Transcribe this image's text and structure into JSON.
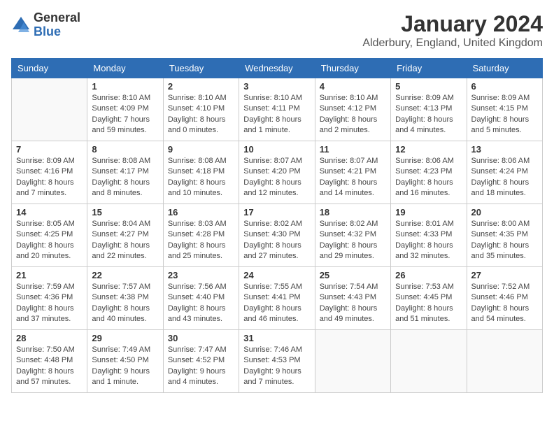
{
  "header": {
    "logo_general": "General",
    "logo_blue": "Blue",
    "month_year": "January 2024",
    "location": "Alderbury, England, United Kingdom"
  },
  "days_of_week": [
    "Sunday",
    "Monday",
    "Tuesday",
    "Wednesday",
    "Thursday",
    "Friday",
    "Saturday"
  ],
  "weeks": [
    [
      {
        "day": "",
        "sunrise": "",
        "sunset": "",
        "daylight": ""
      },
      {
        "day": "1",
        "sunrise": "Sunrise: 8:10 AM",
        "sunset": "Sunset: 4:09 PM",
        "daylight": "Daylight: 7 hours and 59 minutes."
      },
      {
        "day": "2",
        "sunrise": "Sunrise: 8:10 AM",
        "sunset": "Sunset: 4:10 PM",
        "daylight": "Daylight: 8 hours and 0 minutes."
      },
      {
        "day": "3",
        "sunrise": "Sunrise: 8:10 AM",
        "sunset": "Sunset: 4:11 PM",
        "daylight": "Daylight: 8 hours and 1 minute."
      },
      {
        "day": "4",
        "sunrise": "Sunrise: 8:10 AM",
        "sunset": "Sunset: 4:12 PM",
        "daylight": "Daylight: 8 hours and 2 minutes."
      },
      {
        "day": "5",
        "sunrise": "Sunrise: 8:09 AM",
        "sunset": "Sunset: 4:13 PM",
        "daylight": "Daylight: 8 hours and 4 minutes."
      },
      {
        "day": "6",
        "sunrise": "Sunrise: 8:09 AM",
        "sunset": "Sunset: 4:15 PM",
        "daylight": "Daylight: 8 hours and 5 minutes."
      }
    ],
    [
      {
        "day": "7",
        "sunrise": "Sunrise: 8:09 AM",
        "sunset": "Sunset: 4:16 PM",
        "daylight": "Daylight: 8 hours and 7 minutes."
      },
      {
        "day": "8",
        "sunrise": "Sunrise: 8:08 AM",
        "sunset": "Sunset: 4:17 PM",
        "daylight": "Daylight: 8 hours and 8 minutes."
      },
      {
        "day": "9",
        "sunrise": "Sunrise: 8:08 AM",
        "sunset": "Sunset: 4:18 PM",
        "daylight": "Daylight: 8 hours and 10 minutes."
      },
      {
        "day": "10",
        "sunrise": "Sunrise: 8:07 AM",
        "sunset": "Sunset: 4:20 PM",
        "daylight": "Daylight: 8 hours and 12 minutes."
      },
      {
        "day": "11",
        "sunrise": "Sunrise: 8:07 AM",
        "sunset": "Sunset: 4:21 PM",
        "daylight": "Daylight: 8 hours and 14 minutes."
      },
      {
        "day": "12",
        "sunrise": "Sunrise: 8:06 AM",
        "sunset": "Sunset: 4:23 PM",
        "daylight": "Daylight: 8 hours and 16 minutes."
      },
      {
        "day": "13",
        "sunrise": "Sunrise: 8:06 AM",
        "sunset": "Sunset: 4:24 PM",
        "daylight": "Daylight: 8 hours and 18 minutes."
      }
    ],
    [
      {
        "day": "14",
        "sunrise": "Sunrise: 8:05 AM",
        "sunset": "Sunset: 4:25 PM",
        "daylight": "Daylight: 8 hours and 20 minutes."
      },
      {
        "day": "15",
        "sunrise": "Sunrise: 8:04 AM",
        "sunset": "Sunset: 4:27 PM",
        "daylight": "Daylight: 8 hours and 22 minutes."
      },
      {
        "day": "16",
        "sunrise": "Sunrise: 8:03 AM",
        "sunset": "Sunset: 4:28 PM",
        "daylight": "Daylight: 8 hours and 25 minutes."
      },
      {
        "day": "17",
        "sunrise": "Sunrise: 8:02 AM",
        "sunset": "Sunset: 4:30 PM",
        "daylight": "Daylight: 8 hours and 27 minutes."
      },
      {
        "day": "18",
        "sunrise": "Sunrise: 8:02 AM",
        "sunset": "Sunset: 4:32 PM",
        "daylight": "Daylight: 8 hours and 29 minutes."
      },
      {
        "day": "19",
        "sunrise": "Sunrise: 8:01 AM",
        "sunset": "Sunset: 4:33 PM",
        "daylight": "Daylight: 8 hours and 32 minutes."
      },
      {
        "day": "20",
        "sunrise": "Sunrise: 8:00 AM",
        "sunset": "Sunset: 4:35 PM",
        "daylight": "Daylight: 8 hours and 35 minutes."
      }
    ],
    [
      {
        "day": "21",
        "sunrise": "Sunrise: 7:59 AM",
        "sunset": "Sunset: 4:36 PM",
        "daylight": "Daylight: 8 hours and 37 minutes."
      },
      {
        "day": "22",
        "sunrise": "Sunrise: 7:57 AM",
        "sunset": "Sunset: 4:38 PM",
        "daylight": "Daylight: 8 hours and 40 minutes."
      },
      {
        "day": "23",
        "sunrise": "Sunrise: 7:56 AM",
        "sunset": "Sunset: 4:40 PM",
        "daylight": "Daylight: 8 hours and 43 minutes."
      },
      {
        "day": "24",
        "sunrise": "Sunrise: 7:55 AM",
        "sunset": "Sunset: 4:41 PM",
        "daylight": "Daylight: 8 hours and 46 minutes."
      },
      {
        "day": "25",
        "sunrise": "Sunrise: 7:54 AM",
        "sunset": "Sunset: 4:43 PM",
        "daylight": "Daylight: 8 hours and 49 minutes."
      },
      {
        "day": "26",
        "sunrise": "Sunrise: 7:53 AM",
        "sunset": "Sunset: 4:45 PM",
        "daylight": "Daylight: 8 hours and 51 minutes."
      },
      {
        "day": "27",
        "sunrise": "Sunrise: 7:52 AM",
        "sunset": "Sunset: 4:46 PM",
        "daylight": "Daylight: 8 hours and 54 minutes."
      }
    ],
    [
      {
        "day": "28",
        "sunrise": "Sunrise: 7:50 AM",
        "sunset": "Sunset: 4:48 PM",
        "daylight": "Daylight: 8 hours and 57 minutes."
      },
      {
        "day": "29",
        "sunrise": "Sunrise: 7:49 AM",
        "sunset": "Sunset: 4:50 PM",
        "daylight": "Daylight: 9 hours and 1 minute."
      },
      {
        "day": "30",
        "sunrise": "Sunrise: 7:47 AM",
        "sunset": "Sunset: 4:52 PM",
        "daylight": "Daylight: 9 hours and 4 minutes."
      },
      {
        "day": "31",
        "sunrise": "Sunrise: 7:46 AM",
        "sunset": "Sunset: 4:53 PM",
        "daylight": "Daylight: 9 hours and 7 minutes."
      },
      {
        "day": "",
        "sunrise": "",
        "sunset": "",
        "daylight": ""
      },
      {
        "day": "",
        "sunrise": "",
        "sunset": "",
        "daylight": ""
      },
      {
        "day": "",
        "sunrise": "",
        "sunset": "",
        "daylight": ""
      }
    ]
  ]
}
